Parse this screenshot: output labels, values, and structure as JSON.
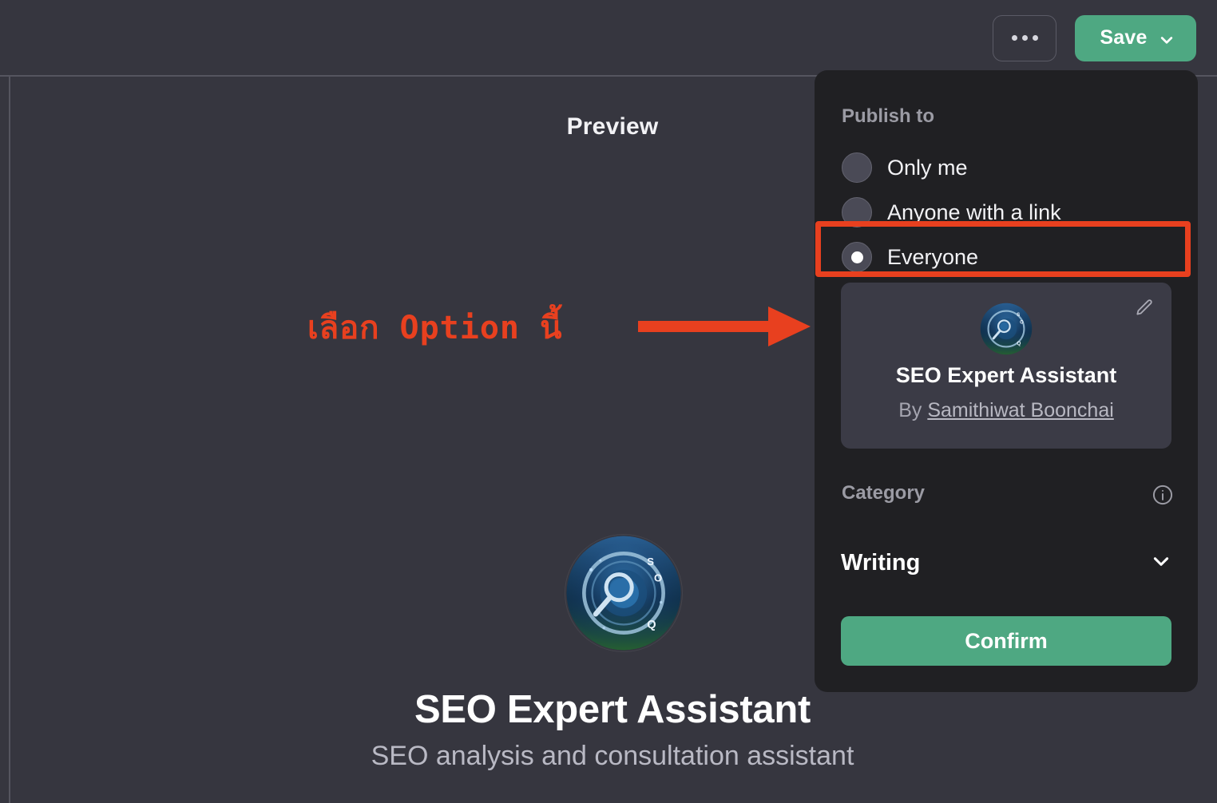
{
  "colors": {
    "app_background": "#36363F",
    "panel_background": "#202023",
    "accent_green": "#4EA882",
    "annotation_red": "#E8401F",
    "card_background": "#3B3B46"
  },
  "toolbar": {
    "more_label": "…",
    "more_icon": "ellipsis-horizontal-icon",
    "save_label": "Save",
    "save_chevron_icon": "chevron-down-icon"
  },
  "preview": {
    "title": "Preview",
    "bot_name": "SEO Expert Assistant",
    "bot_description": "SEO analysis and consultation assistant",
    "avatar_icon": "seo-magnifier-logo"
  },
  "annotation": {
    "text": "เลือก Option นี้",
    "arrow_icon": "arrow-right-icon",
    "highlight_target": "Everyone"
  },
  "panel": {
    "publish_to": {
      "label": "Publish to",
      "options": [
        {
          "label": "Only me",
          "selected": false
        },
        {
          "label": "Anyone with a link",
          "selected": false
        },
        {
          "label": "Everyone",
          "selected": true
        }
      ]
    },
    "bot_card": {
      "name": "SEO Expert Assistant",
      "by_prefix": "By ",
      "author": "Samithiwat Boonchai",
      "edit_icon": "pencil-icon",
      "avatar_icon": "seo-magnifier-logo"
    },
    "category": {
      "label": "Category",
      "info_icon": "info-circle-icon",
      "value": "Writing",
      "chevron_icon": "chevron-down-icon"
    },
    "confirm_label": "Confirm"
  }
}
